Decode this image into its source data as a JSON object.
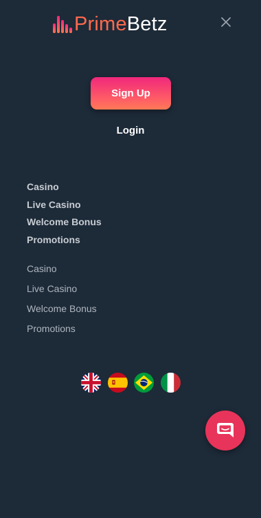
{
  "header": {
    "logo_part1": "Prime",
    "logo_part2": "Betz",
    "close_icon": "close-icon"
  },
  "auth": {
    "signup_label": "Sign Up",
    "login_label": "Login"
  },
  "menu_primary": {
    "items": [
      {
        "label": "Casino"
      },
      {
        "label": "Live Casino"
      },
      {
        "label": "Welcome Bonus"
      },
      {
        "label": "Promotions"
      }
    ]
  },
  "menu_secondary": {
    "items": [
      {
        "label": "Casino"
      },
      {
        "label": "Live Casino"
      },
      {
        "label": "Welcome Bonus"
      },
      {
        "label": "Promotions"
      }
    ]
  },
  "languages": [
    {
      "icon": "uk-flag-icon"
    },
    {
      "icon": "spain-flag-icon"
    },
    {
      "icon": "brazil-flag-icon"
    },
    {
      "icon": "italy-flag-icon"
    }
  ],
  "chat": {
    "icon": "chat-bubble-icon"
  },
  "colors": {
    "background": "#1d2a38",
    "brand_accent": "#ff6a4d",
    "signup_gradient_top": "#f0277c",
    "signup_gradient_bottom": "#ff7a55",
    "chat_button": "#e8345a"
  }
}
